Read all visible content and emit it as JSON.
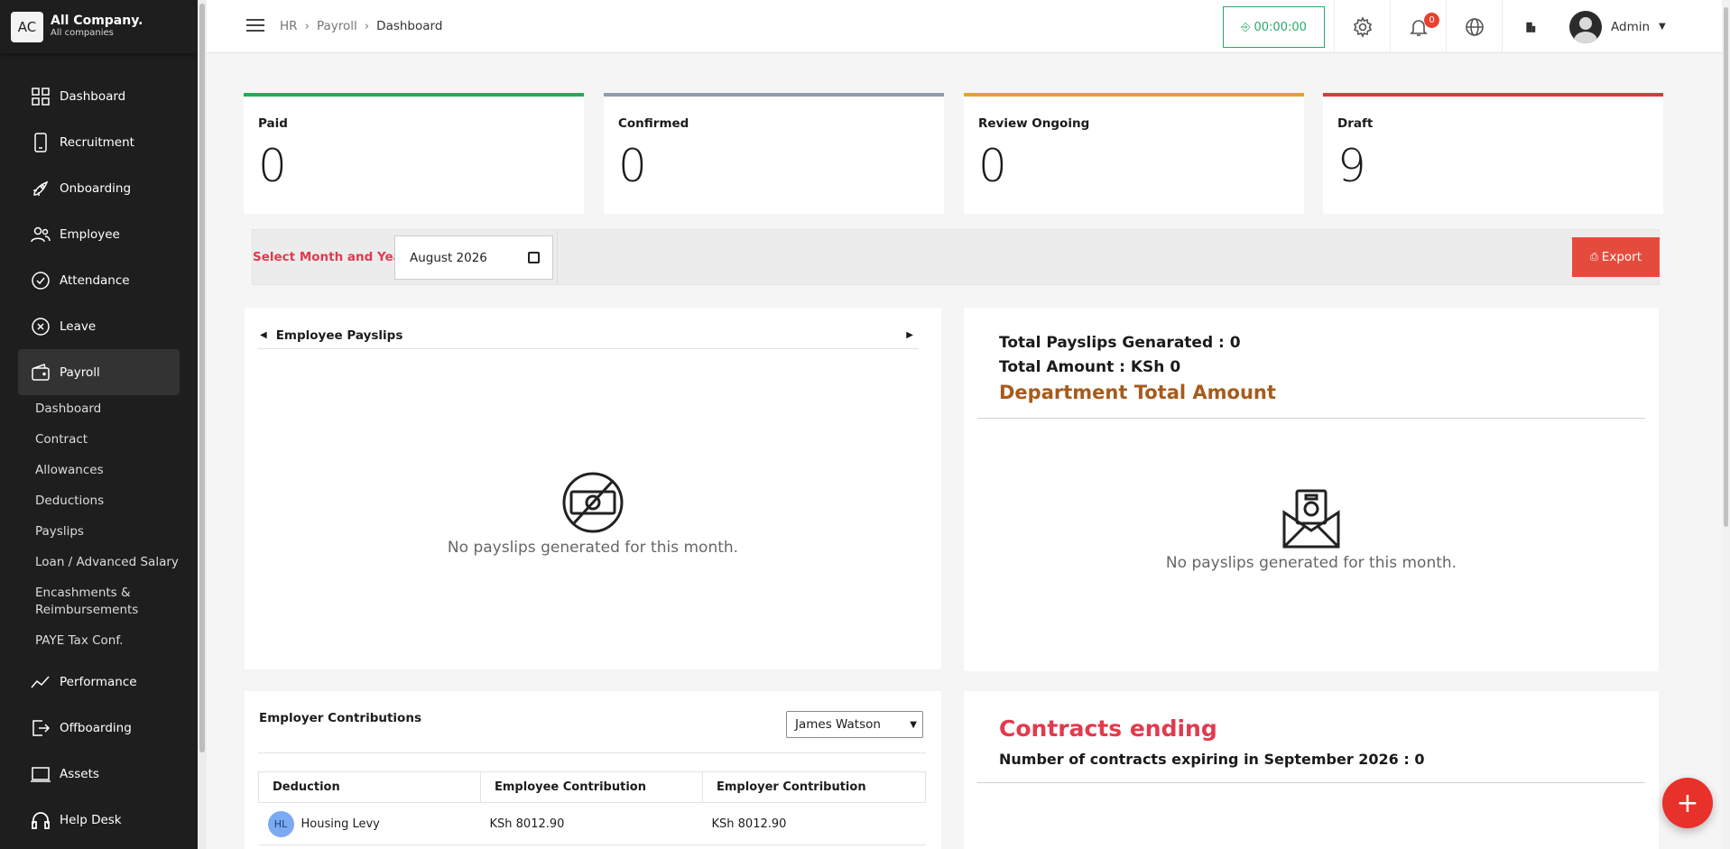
{
  "sidebar": {
    "company_badge": "AC",
    "company_name": "All Company.",
    "company_sub": "All companies",
    "items": [
      {
        "label": "Dashboard"
      },
      {
        "label": "Recruitment"
      },
      {
        "label": "Onboarding"
      },
      {
        "label": "Employee"
      },
      {
        "label": "Attendance"
      },
      {
        "label": "Leave"
      },
      {
        "label": "Payroll"
      },
      {
        "label": "Performance"
      },
      {
        "label": "Offboarding"
      },
      {
        "label": "Assets"
      },
      {
        "label": "Help Desk"
      }
    ],
    "payroll_sub": [
      "Dashboard",
      "Contract",
      "Allowances",
      "Deductions",
      "Payslips",
      "Loan / Advanced Salary",
      "Encashments & Reimbursements",
      "PAYE Tax Conf."
    ]
  },
  "topbar": {
    "breadcrumb": [
      "HR",
      "Payroll",
      "Dashboard"
    ],
    "timer": "00:00:00",
    "notif_count": "0",
    "user": "Admin"
  },
  "stats": [
    {
      "label": "Paid",
      "value": "0",
      "color": "#27a957"
    },
    {
      "label": "Confirmed",
      "value": "0",
      "color": "#8f9cab"
    },
    {
      "label": "Review Ongoing",
      "value": "0",
      "color": "#e3a132"
    },
    {
      "label": "Draft",
      "value": "9",
      "color": "#d83a3d"
    }
  ],
  "filter": {
    "label": "Select Month and Year:",
    "value": "August 2026",
    "export": "Export"
  },
  "payslips_panel": {
    "title": "Employee Payslips",
    "empty": "No payslips generated for this month."
  },
  "summary_panel": {
    "total_generated": "Total Payslips Genarated : 0",
    "total_amount": "Total Amount : KSh 0",
    "dept_title": "Department Total Amount",
    "empty": "No payslips generated for this month."
  },
  "contributions": {
    "title": "Employer Contributions",
    "selected_employee": "James Watson",
    "headers": [
      "Deduction",
      "Employee Contribution",
      "Employer Contribution"
    ],
    "rows": [
      {
        "initials": "HL",
        "name": "Housing Levy",
        "employee": "KSh 8012.90",
        "employer": "KSh 8012.90"
      }
    ]
  },
  "contracts": {
    "title": "Contracts ending",
    "subtitle": "Number of contracts expiring in September 2026 : 0"
  }
}
